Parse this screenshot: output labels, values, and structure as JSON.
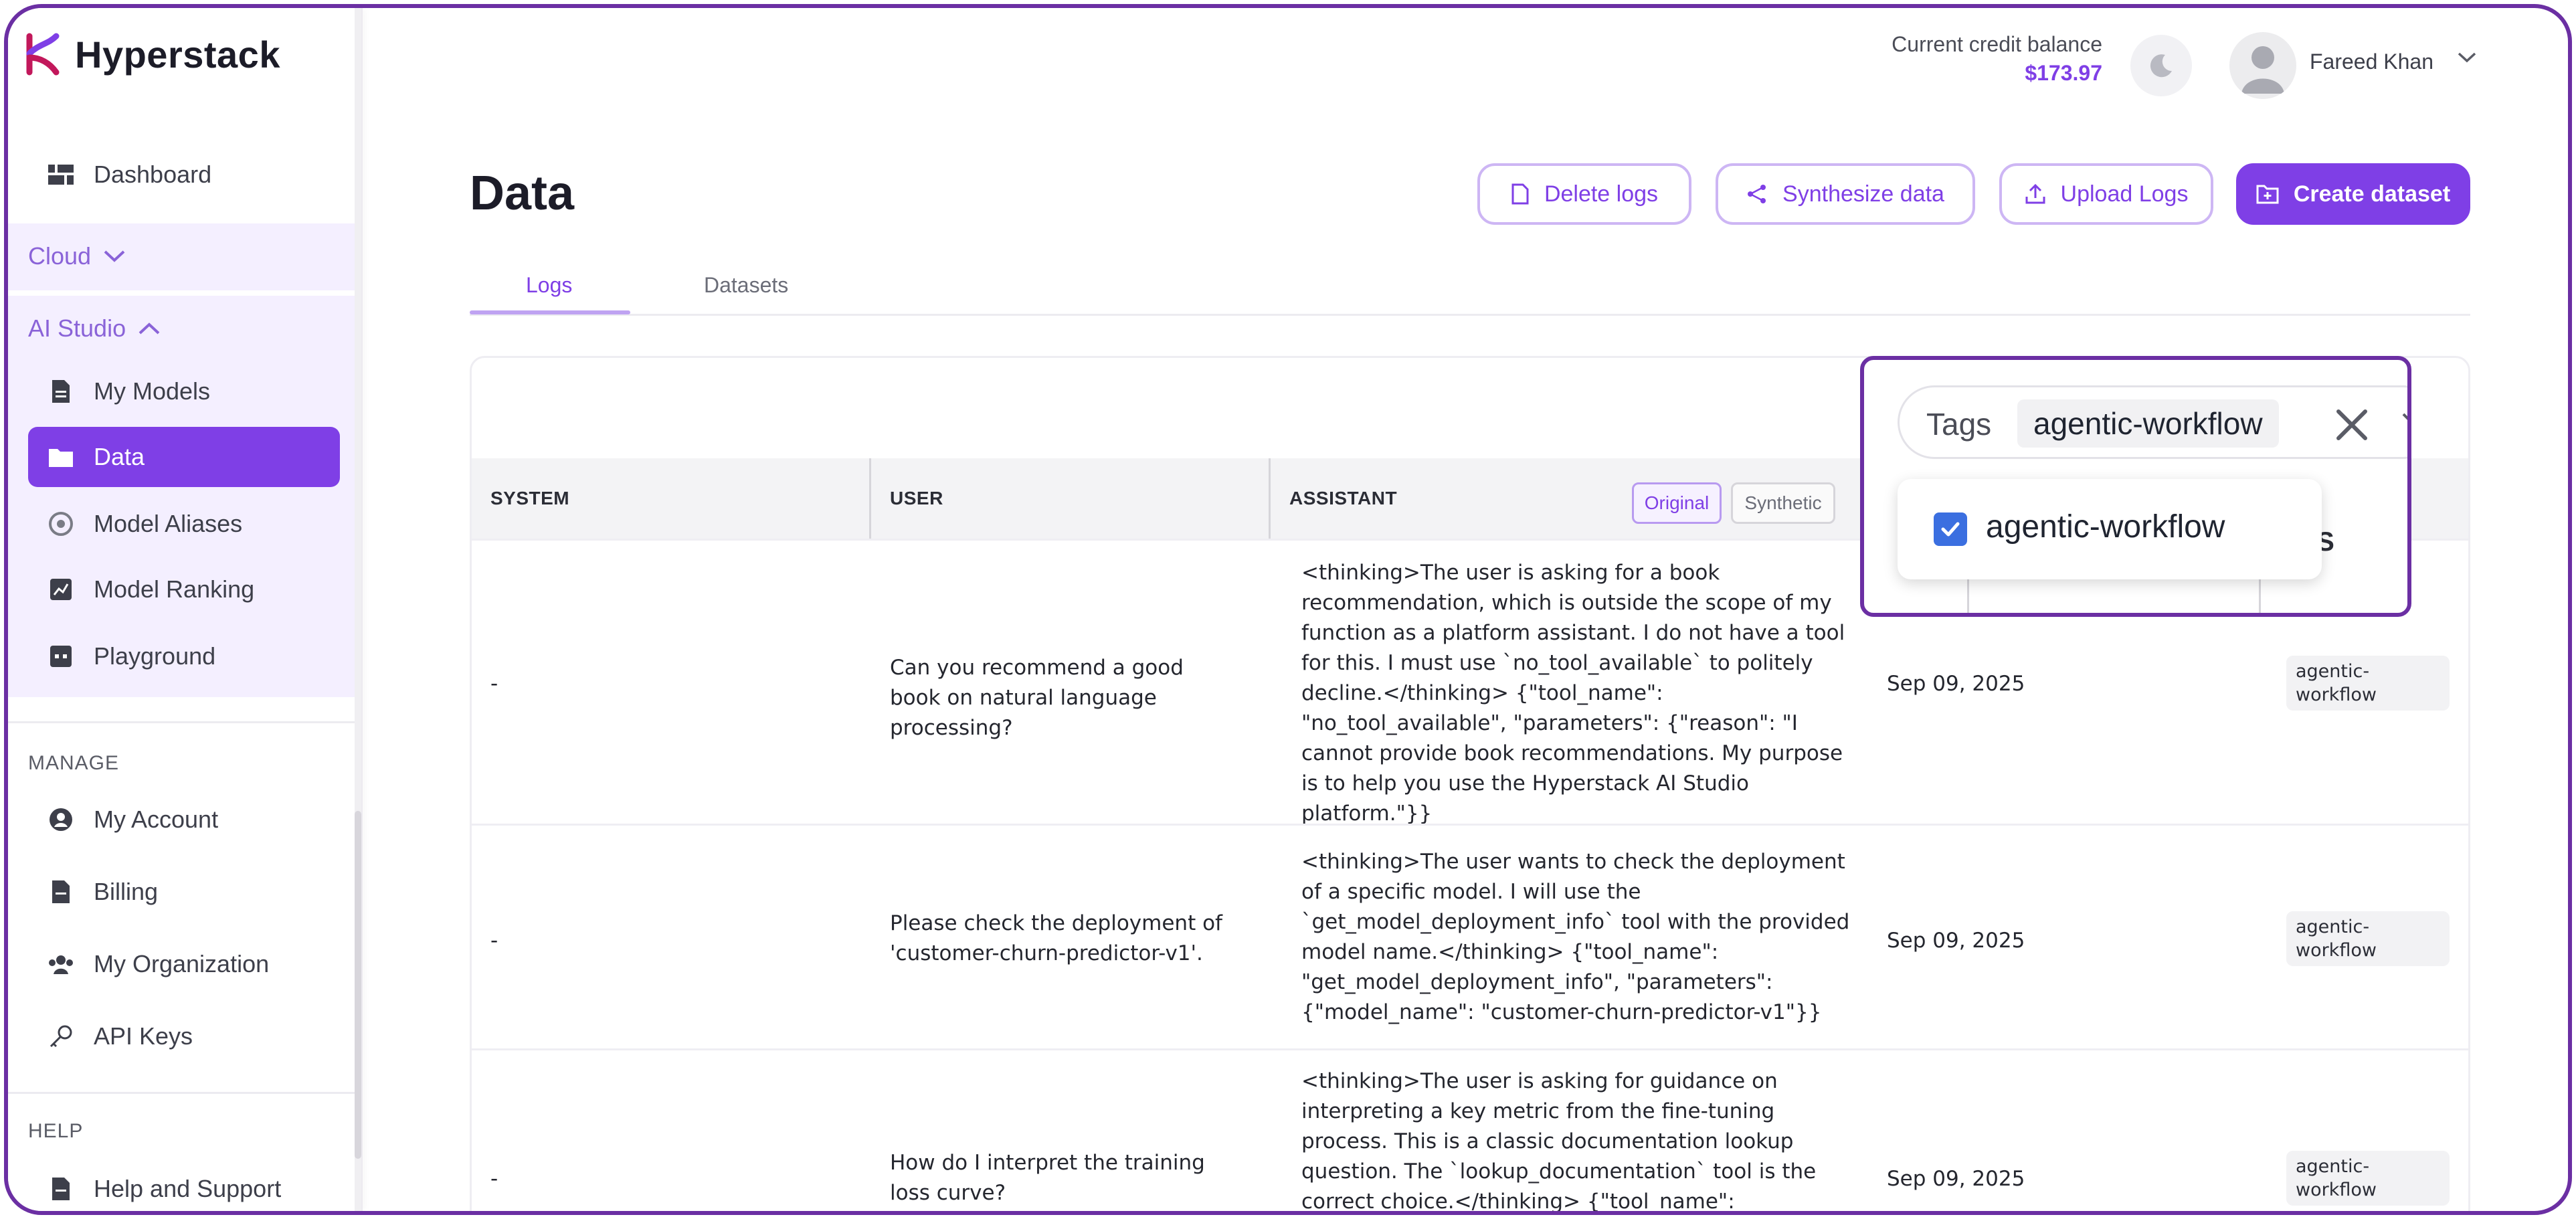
{
  "brand": {
    "name": "Hyperstack",
    "accent": "#7f3fe6",
    "frame_color": "#6b2fa3"
  },
  "sidebar": {
    "dashboard": "Dashboard",
    "cloud": "Cloud",
    "ai_studio": "AI Studio",
    "ai_items": [
      {
        "label": "My Models",
        "icon": "document-icon"
      },
      {
        "label": "Data",
        "icon": "folder-icon",
        "active": true
      },
      {
        "label": "Model Aliases",
        "icon": "alias-icon"
      },
      {
        "label": "Model Ranking",
        "icon": "ranking-icon"
      },
      {
        "label": "Playground",
        "icon": "playground-icon"
      }
    ],
    "manage_label": "MANAGE",
    "manage_items": [
      {
        "label": "My Account",
        "icon": "account-icon"
      },
      {
        "label": "Billing",
        "icon": "billing-icon"
      },
      {
        "label": "My Organization",
        "icon": "organization-icon"
      },
      {
        "label": "API Keys",
        "icon": "key-icon"
      }
    ],
    "help_label": "HELP",
    "help_items": [
      {
        "label": "Help and Support",
        "icon": "help-icon"
      }
    ]
  },
  "header": {
    "credit_label": "Current credit balance",
    "credit_value": "$173.97",
    "user_name": "Fareed Khan"
  },
  "page": {
    "title": "Data",
    "buttons": {
      "delete": "Delete logs",
      "synthesize": "Synthesize data",
      "upload": "Upload Logs",
      "create": "Create dataset"
    },
    "tabs": [
      "Logs",
      "Datasets"
    ],
    "active_tab": "Logs"
  },
  "table": {
    "columns": {
      "system": "SYSTEM",
      "user": "USER",
      "assistant": "ASSISTANT",
      "tags_tail": "GS"
    },
    "toggle": {
      "original": "Original",
      "synthetic": "Synthetic"
    },
    "rows": [
      {
        "system": "-",
        "user": "Can you recommend a good book on natural language processing?",
        "assistant": "<thinking>The user is asking for a book recommendation, which is outside the scope of my function as a platform assistant. I do not have a tool for this. I must use `no_tool_available` to politely decline.</thinking> {\"tool_name\": \"no_tool_available\", \"parameters\": {\"reason\": \"I cannot provide book recommendations. My purpose is to help you use the Hyperstack AI Studio platform.\"}}",
        "date": "Sep 09, 2025",
        "tag": "agentic-workflow"
      },
      {
        "system": "-",
        "user": "Please check the deployment of 'customer-churn-predictor-v1'.",
        "assistant": "<thinking>The user wants to check the deployment of a specific model. I will use the `get_model_deployment_info` tool with the provided model name.</thinking> {\"tool_name\": \"get_model_deployment_info\", \"parameters\": {\"model_name\": \"customer-churn-predictor-v1\"}}",
        "date": "Sep 09, 2025",
        "tag": "agentic-workflow"
      },
      {
        "system": "-",
        "user": "How do I interpret the training loss curve?",
        "assistant": "<thinking>The user is asking for guidance on interpreting a key metric from the fine-tuning process. This is a classic documentation lookup question. The `lookup_documentation` tool is the correct choice.</thinking> {\"tool_name\":",
        "date": "Sep 09, 2025",
        "tag": "agentic-workflow"
      }
    ]
  },
  "filter_popup": {
    "label": "Tags",
    "selected_chip": "agentic-workflow",
    "option": "agentic-workflow",
    "option_checked": true
  }
}
